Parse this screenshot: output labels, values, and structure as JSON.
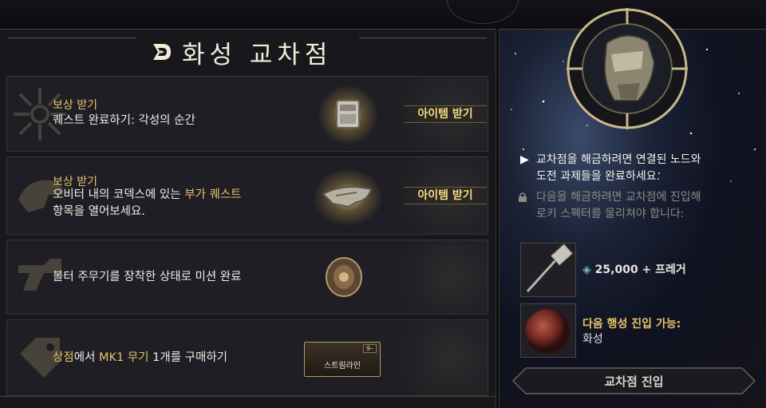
{
  "title": "화성 교차점",
  "colors": {
    "accent_gold": "#e6c36a",
    "panel_bg": "#17171c",
    "row_bg": "#1e1e24"
  },
  "tasks": [
    {
      "label": "보상 받기",
      "desc_line1": "퀘스트 완료하기: 각성의 순간",
      "reward_icon": "armor-chest-icon",
      "button": "아이템 받기"
    },
    {
      "label": "보상 받기",
      "desc_line1_a": "오비터 내의 코덱스에 있는 ",
      "desc_line1_b": "부가 퀘스트",
      "desc_line2": "항목을 열어보세요.",
      "reward_icon": "helmet-blueprint-icon",
      "button": "아이템 받기"
    },
    {
      "desc_line1": "볼터 주무기를 장착한 상태로 미션 완료",
      "reward_icon": "orb-relic-icon"
    },
    {
      "desc_a": "상점",
      "desc_b": "에서 ",
      "desc_c": "MK1 무기",
      "desc_d": " 1개를 구매하기",
      "reward_icon": "weapon-card-icon",
      "reward_card_label": "스트림라인",
      "reward_card_badge": "9–"
    }
  ],
  "side": {
    "info_text_line1": "교차점을 해금하려면 연결된 노드와",
    "info_text_line2": "도전 과제들을 완료하세요.",
    "locked_text_line1": "다음을 해금하려면 교차점에 진입해",
    "locked_text_line2": "로키 스펙터를 물리쳐야 합니다:",
    "req1_value": "25,000 + 프레거",
    "req2_line1": "다음 행성 진입 가능:",
    "req2_line2": "화성",
    "enter_button": "교차점 진입"
  }
}
